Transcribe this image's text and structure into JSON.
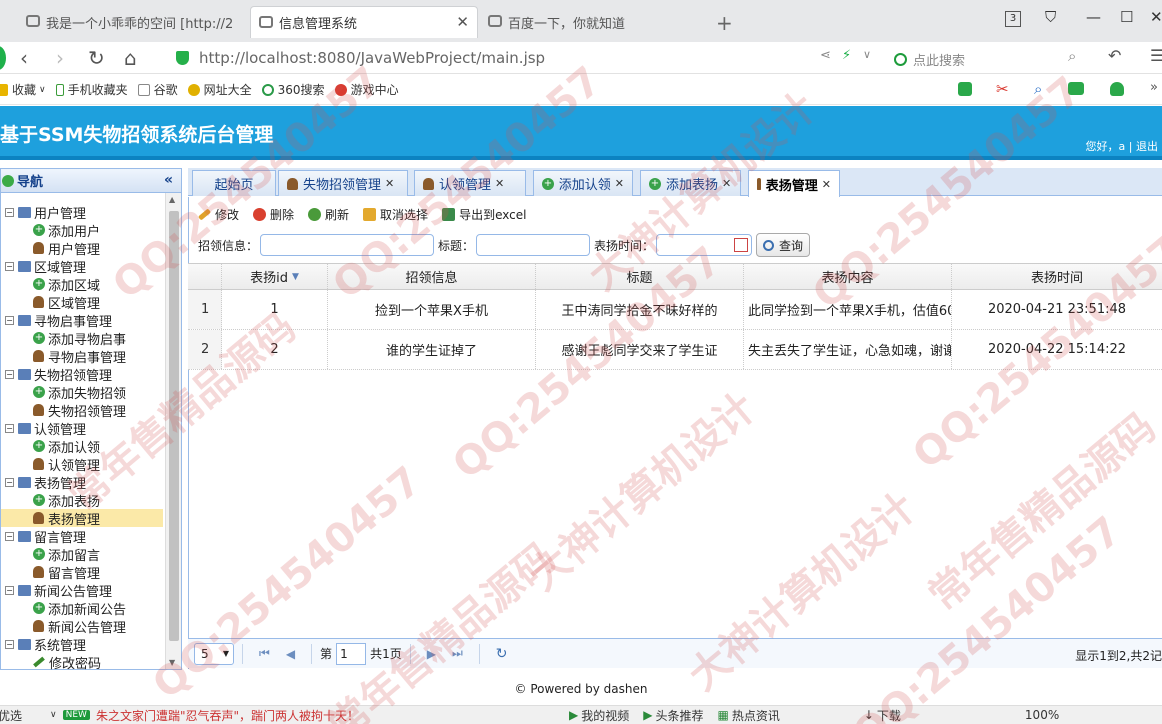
{
  "browser": {
    "tabs": [
      {
        "title": "我是一个小乖乖的空间 [http://2"
      },
      {
        "title": "信息管理系统"
      },
      {
        "title": "百度一下，你就知道"
      }
    ],
    "tab_count": "3",
    "url": "http://localhost:8080/JavaWebProject/main.jsp",
    "search_placeholder": "点此搜索",
    "bookmarks": [
      "收藏",
      "手机收藏夹",
      "谷歌",
      "网址大全",
      "360搜索",
      "游戏中心"
    ]
  },
  "app": {
    "title": "基于SSM失物招领系统后台管理",
    "user_info": "您好，a | 退出"
  },
  "sidebar": {
    "title": "导航",
    "collapse": "«",
    "groups": [
      {
        "label": "用户管理",
        "items": [
          {
            "label": "添加用户",
            "icon": "add-icon"
          },
          {
            "label": "用户管理",
            "icon": "user-icon"
          }
        ]
      },
      {
        "label": "区域管理",
        "items": [
          {
            "label": "添加区域",
            "icon": "add-icon"
          },
          {
            "label": "区域管理",
            "icon": "user-icon"
          }
        ]
      },
      {
        "label": "寻物启事管理",
        "items": [
          {
            "label": "添加寻物启事",
            "icon": "add-icon"
          },
          {
            "label": "寻物启事管理",
            "icon": "user-icon"
          }
        ]
      },
      {
        "label": "失物招领管理",
        "items": [
          {
            "label": "添加失物招领",
            "icon": "add-icon"
          },
          {
            "label": "失物招领管理",
            "icon": "user-icon"
          }
        ]
      },
      {
        "label": "认领管理",
        "items": [
          {
            "label": "添加认领",
            "icon": "add-icon"
          },
          {
            "label": "认领管理",
            "icon": "user-icon"
          }
        ]
      },
      {
        "label": "表扬管理",
        "items": [
          {
            "label": "添加表扬",
            "icon": "add-icon"
          },
          {
            "label": "表扬管理",
            "icon": "user-icon",
            "selected": true
          }
        ]
      },
      {
        "label": "留言管理",
        "items": [
          {
            "label": "添加留言",
            "icon": "add-icon"
          },
          {
            "label": "留言管理",
            "icon": "user-icon"
          }
        ]
      },
      {
        "label": "新闻公告管理",
        "items": [
          {
            "label": "添加新闻公告",
            "icon": "add-icon"
          },
          {
            "label": "新闻公告管理",
            "icon": "user-icon"
          }
        ]
      },
      {
        "label": "系统管理",
        "items": [
          {
            "label": "修改密码",
            "icon": "pencil-icon"
          }
        ]
      }
    ]
  },
  "content_tabs": [
    {
      "label": "起始页",
      "icon": "",
      "closable": false
    },
    {
      "label": "失物招领管理",
      "icon": "user",
      "closable": true
    },
    {
      "label": "认领管理",
      "icon": "user",
      "closable": true
    },
    {
      "label": "添加认领",
      "icon": "add",
      "closable": true
    },
    {
      "label": "添加表扬",
      "icon": "add",
      "closable": true
    },
    {
      "label": "表扬管理",
      "icon": "user",
      "closable": true,
      "active": true
    }
  ],
  "toolbar": {
    "edit": "修改",
    "delete": "删除",
    "refresh": "刷新",
    "cancel_select": "取消选择",
    "export": "导出到excel"
  },
  "search": {
    "lost_info_label": "招领信息：",
    "title_label": "标题：",
    "time_label": "表扬时间：",
    "query_button": "查询"
  },
  "grid": {
    "columns": [
      "表扬id",
      "招领信息",
      "标题",
      "表扬内容",
      "表扬时间"
    ],
    "rows": [
      {
        "rownum": "1",
        "id": "1",
        "lost_info": "捡到一个苹果X手机",
        "title": "王中涛同学拾金不昧好样的",
        "content": "此同学捡到一个苹果X手机，估值60",
        "time": "2020-04-21 23:51:48"
      },
      {
        "rownum": "2",
        "id": "2",
        "lost_info": "谁的学生证掉了",
        "title": "感谢王彪同学交来了学生证",
        "content": "失主丢失了学生证，心急如魂，谢谢",
        "time": "2020-04-22 15:14:22"
      }
    ]
  },
  "pager": {
    "page_size": "5",
    "page_prefix": "第",
    "page_value": "1",
    "page_suffix": "共1页",
    "info": "显示1到2,共2记"
  },
  "footer": "© Powered by dashen",
  "statusbar": {
    "left": "优选",
    "news_badge": "NEW",
    "news": "朱之文家门遭踹\"忍气吞声\"，踹门两人被拘十天！",
    "items": [
      "我的视频",
      "头条推荐",
      "热点资讯",
      "下载"
    ],
    "zoom": "100%"
  },
  "watermarks": [
    "QQ:254540457",
    "大神计算机设计",
    "常年售精品源码"
  ]
}
